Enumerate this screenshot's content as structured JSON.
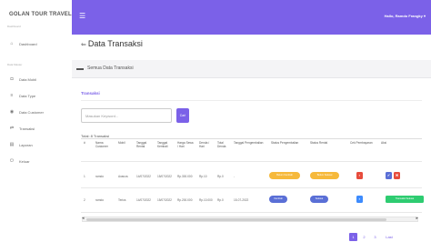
{
  "sidebar": {
    "brand": "GOLAN TOUR TRAVEL",
    "dashboard_heading": "Dashboard",
    "data_master_heading": "Data Master",
    "items": [
      {
        "icon": "home-icon",
        "glyph": "⌂",
        "label": "Dashboard"
      },
      {
        "icon": "car-icon",
        "glyph": "◘",
        "label": "Data Mobil"
      },
      {
        "icon": "list-icon",
        "glyph": "≡",
        "label": "Data Type"
      },
      {
        "icon": "users-icon",
        "glyph": "◉",
        "label": "Data Customer"
      },
      {
        "icon": "transfer-icon",
        "glyph": "⇄",
        "label": "Transaksi"
      },
      {
        "icon": "report-icon",
        "glyph": "▤",
        "label": "Laporan"
      },
      {
        "icon": "power-icon",
        "glyph": "⏻",
        "label": "Keluar"
      }
    ]
  },
  "header": {
    "menu_icon": "hamburger-icon",
    "user": "Hallo, Ramdo Frangky ▾",
    "accent": "#7b61e8"
  },
  "page": {
    "title": "Data Transaksi",
    "card_title": "Semua Data Transaksi",
    "section_label": "Transaksi",
    "search_placeholder": "Masukan Keyword...",
    "search_button": "Cari",
    "total": "Total: 8 Transaksi"
  },
  "table": {
    "headers": [
      "#",
      "Nama Customer",
      "Mobil",
      "Tanggal Rental",
      "Tanggal Kembali",
      "Harga Sewa / Hari",
      "Denda / Hari",
      "Total Denda",
      "Tanggal Pengembalian",
      "Status Pengembalian",
      "Status Rental",
      "Cek Pembayaran",
      "Aksi"
    ],
    "rows": [
      {
        "cells": [
          "1",
          "ramdo",
          "Avanza",
          "14/07/2022",
          "15/07/2022",
          "Rp.300.000",
          "Rp.10",
          "Rp.0",
          "-"
        ],
        "status_pengembalian": "Belum Kembali",
        "status_rental": "Belum Selesai",
        "pengembalian_color": "#f6b93b",
        "rental_color": "#f6b93b",
        "aksi": [
          "✔",
          "✖"
        ]
      },
      {
        "cells": [
          "2",
          "ramdo",
          "Terios",
          "14/07/2022",
          "15/07/2022",
          "Rp.200.000",
          "Rp.10.000",
          "Rp.0",
          "15-07-2022"
        ],
        "status_pengembalian": "Kembali",
        "status_rental": "Selesai",
        "pengembalian_color": "#5a6fd6",
        "rental_color": "#5a6fd6",
        "aksi": [
          "Transaksi Selesai"
        ]
      }
    ]
  },
  "pagination": [
    "1",
    "2",
    "3",
    "Last"
  ]
}
